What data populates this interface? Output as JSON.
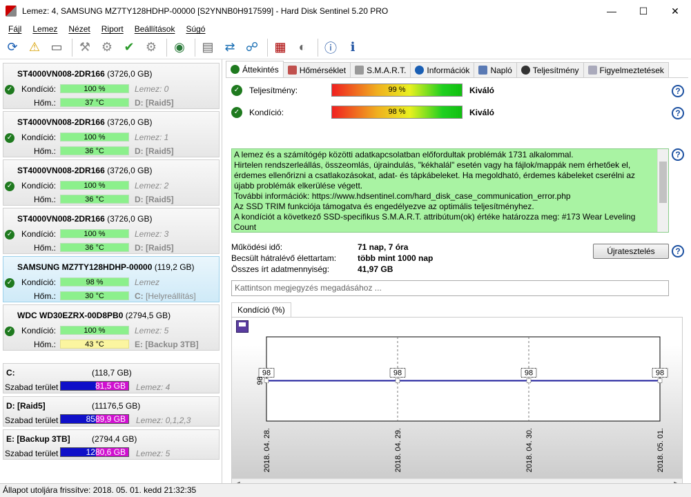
{
  "window": {
    "title": "Lemez: 4, SAMSUNG MZ7TY128HDHP-00000 [S2YNNB0H917599]  -  Hard Disk Sentinel 5.20 PRO",
    "min": "—",
    "max": "☐",
    "close": "✕"
  },
  "menu": [
    "Fájl",
    "Lemez",
    "Nézet",
    "Riport",
    "Beállítások",
    "Súgó"
  ],
  "toolbar": [
    "refresh-icon",
    "warning-icon",
    "disk-icon",
    "tool-icon",
    "tool-check-icon",
    "tool-ok-icon",
    "tool-alt-icon",
    "globe-icon",
    "report-icon",
    "sync-icon",
    "network-icon",
    "chart-icon",
    "speaker-icon",
    "help-icon",
    "info-icon"
  ],
  "labels": {
    "kondicio": "Kondíció:",
    "hom": "Hőm.:",
    "szabad": "Szabad terület"
  },
  "disks": [
    {
      "model": "ST4000VN008-2DR166",
      "size": "(3726,0 GB)",
      "cond": "100 %",
      "temp": "37 °C",
      "lemez": "Lemez: 0",
      "part": "D: [Raid5]",
      "yellow": false,
      "selected": false
    },
    {
      "model": "ST4000VN008-2DR166",
      "size": "(3726,0 GB)",
      "cond": "100 %",
      "temp": "36 °C",
      "lemez": "Lemez: 1",
      "part": "D: [Raid5]",
      "yellow": false,
      "selected": false
    },
    {
      "model": "ST4000VN008-2DR166",
      "size": "(3726,0 GB)",
      "cond": "100 %",
      "temp": "36 °C",
      "lemez": "Lemez: 2",
      "part": "D: [Raid5]",
      "yellow": false,
      "selected": false
    },
    {
      "model": "ST4000VN008-2DR166",
      "size": "(3726,0 GB)",
      "cond": "100 %",
      "temp": "36 °C",
      "lemez": "Lemez: 3",
      "part": "D: [Raid5]",
      "yellow": false,
      "selected": false
    },
    {
      "model": "SAMSUNG MZ7TY128HDHP-00000",
      "size": "(119,2 GB)",
      "cond": "98 %",
      "temp": "30 °C",
      "lemez": "Lemez",
      "part": "C:",
      "part2": "[Helyreállítás]",
      "yellow": false,
      "selected": true
    },
    {
      "model": "WDC WD30EZRX-00D8PB0",
      "size": "(2794,5 GB)",
      "cond": "100 %",
      "temp": "43 °C",
      "lemez": "Lemez: 5",
      "part": "E: [Backup 3TB]",
      "yellow": true,
      "selected": false
    }
  ],
  "volumes": [
    {
      "name": "C:",
      "size": "(118,7 GB)",
      "free": "81,5 GB",
      "disks": "Lemez: 4"
    },
    {
      "name": "D: [Raid5]",
      "size": "(11176,5 GB)",
      "free": "8589,9 GB",
      "disks": "Lemez: 0,1,2,3"
    },
    {
      "name": "E: [Backup 3TB]",
      "size": "(2794,4 GB)",
      "free": "1280,6 GB",
      "disks": "Lemez: 5"
    }
  ],
  "tabs": [
    "Áttekintés",
    "Hőmérséklet",
    "S.M.A.R.T.",
    "Információk",
    "Napló",
    "Teljesítmény",
    "Figyelmeztetések"
  ],
  "overview": {
    "perf_label": "Teljesítmény:",
    "perf_value": "99 %",
    "perf_verdict": "Kiváló",
    "cond_label": "Kondíció:",
    "cond_value": "98 %",
    "cond_verdict": "Kiváló",
    "message": [
      "A lemez és a számítógép közötti adatkapcsolatban előfordultak problémák 1731 alkalommal.",
      "Hirtelen rendszerleállás, összeomlás, újraindulás, \"kékhalál\" esetén vagy ha fájlok/mappák nem érhetőek el,",
      "érdemes ellenőrizni a csatlakozásokat, adat- és tápkábeleket. Ha megoldható, érdemes kábeleket cserélni az",
      "újabb problémák elkerülése végett.",
      "További információk: https://www.hdsentinel.com/hard_disk_case_communication_error.php",
      "Az SSD TRIM funkciója támogatva és engedélyezve az optimális teljesítményhez.",
      "A kondíciót a következő SSD-specifikus S.M.A.R.T. attribútum(ok) értéke határozza meg:  #173 Wear Leveling",
      "Count"
    ],
    "uptime_label": "Működési idő:",
    "uptime": "71 nap, 7 óra",
    "life_label": "Becsült hátralévő élettartam:",
    "life": "több mint 1000 nap",
    "written_label": "Összes írt adatmennyiség:",
    "written": "41,97 GB",
    "retest": "Újratesztelés",
    "note_placeholder": "Kattintson megjegyzés megadásához ...",
    "chart_tab": "Kondíció  (%)"
  },
  "status": "Állapot utoljára frissítve: 2018. 05. 01. kedd 21:32:35",
  "chart_data": {
    "type": "line",
    "title": "",
    "xlabel": "",
    "ylabel": "",
    "categories": [
      "2018. 04. 28.",
      "2018. 04. 29.",
      "2018. 04. 30.",
      "2018. 05. 01."
    ],
    "series": [
      {
        "values": [
          98,
          98,
          98,
          98
        ]
      }
    ],
    "yticks": [
      "98"
    ],
    "grid": true,
    "color": "#1a1a9a"
  }
}
